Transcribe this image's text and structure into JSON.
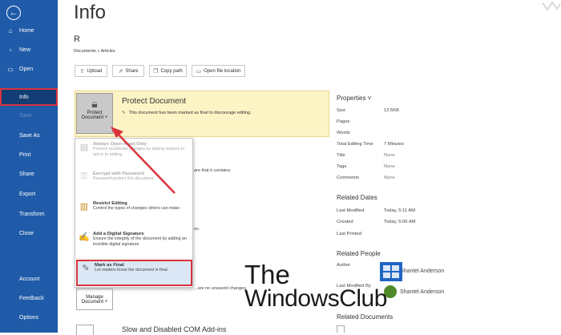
{
  "sidebar": {
    "back_icon": "arrow-left-circle-icon",
    "items": [
      {
        "label": "Home",
        "icon": "home-icon",
        "glyph": "⌂"
      },
      {
        "label": "New",
        "icon": "new-document-icon",
        "glyph": "▫"
      },
      {
        "label": "Open",
        "icon": "open-folder-icon",
        "glyph": "▭"
      },
      {
        "label": "Info",
        "active": true
      },
      {
        "label": "Save",
        "disabled": true
      },
      {
        "label": "Save As"
      },
      {
        "label": "Print"
      },
      {
        "label": "Share"
      },
      {
        "label": "Export"
      },
      {
        "label": "Transform"
      },
      {
        "label": "Close"
      },
      {
        "label": "Account"
      },
      {
        "label": "Feedback"
      },
      {
        "label": "Options"
      }
    ]
  },
  "page": {
    "title": "Info",
    "doc_name": "R",
    "breadcrumb": "Documents » Articles"
  },
  "toolbar": {
    "upload": "Upload",
    "share": "Share",
    "copy_path": "Copy path",
    "open_location": "Open file location"
  },
  "protect": {
    "button_line1": "Protect",
    "button_line2": "Document ˅",
    "title": "Protect Document",
    "description": "This document has been marked as final to discourage editing."
  },
  "protect_menu": [
    {
      "title": "Always Open Read-Only",
      "desc": "Prevent accidental changes by asking readers to opt-in to editing.",
      "disabled": true,
      "icon": "document-lock-icon"
    },
    {
      "title": "Encrypt with Password",
      "desc": "Password-protect this document",
      "disabled": true,
      "icon": "key-lock-icon"
    },
    {
      "title": "Restrict Editing",
      "desc": "Control the types of changes others can make",
      "disabled": false,
      "icon": "restrict-editing-icon"
    },
    {
      "title": "Add a Digital Signature",
      "desc": "Ensure the integrity of the document by adding an invisible digital signature",
      "disabled": false,
      "icon": "signature-icon"
    },
    {
      "title": "Mark as Final",
      "desc": "Let readers know the document is final.",
      "disabled": false,
      "icon": "mark-final-icon",
      "selected": true
    }
  ],
  "behind_text": {
    "inspect": "are that it contains:",
    "ns": "ns.",
    "changes": "...are no unsaved changes."
  },
  "manage": {
    "line1": "Manage",
    "line2": "Document ˅"
  },
  "slow_addins": "Slow and Disabled COM Add-ins",
  "properties": {
    "header": "Properties ˅",
    "rows": [
      {
        "key": "Size",
        "value": "12.5KB"
      },
      {
        "key": "Pages",
        "value": ""
      },
      {
        "key": "Words",
        "value": ""
      },
      {
        "key": "Total Editing Time",
        "value": "7 Minutes"
      },
      {
        "key": "Title",
        "value": "None"
      },
      {
        "key": "Tags",
        "value": "None"
      },
      {
        "key": "Comments",
        "value": "None"
      }
    ]
  },
  "related_dates": {
    "header": "Related Dates",
    "rows": [
      {
        "key": "Last Modified",
        "value": "Today, 5:11 AM"
      },
      {
        "key": "Created",
        "value": "Today, 5:06 AM"
      },
      {
        "key": "Last Printed",
        "value": ""
      }
    ]
  },
  "related_people": {
    "header": "Related People",
    "author_label": "Author",
    "author_name": "Shantel Anderson",
    "modified_label": "Last Modified By",
    "modified_name": "Shantel Anderson"
  },
  "related_documents": {
    "header": "Related Documents"
  },
  "watermark": {
    "line1": "The",
    "line2": "WindowsClub"
  },
  "colors": {
    "sidebar": "#1f5ba8",
    "highlight_red": "#d9343c",
    "protect_bg": "#fdf4c6"
  }
}
